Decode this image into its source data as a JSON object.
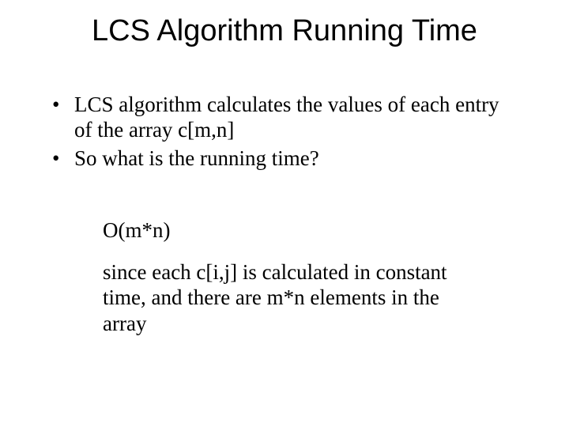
{
  "title": "LCS Algorithm Running Time",
  "bullets": [
    "LCS algorithm calculates the values of each entry of the array c[m,n]",
    "So what is the running time?"
  ],
  "answer": {
    "complexity": "O(m*n)",
    "explanation": "since each c[i,j] is calculated in constant time, and there are m*n elements in the array"
  }
}
